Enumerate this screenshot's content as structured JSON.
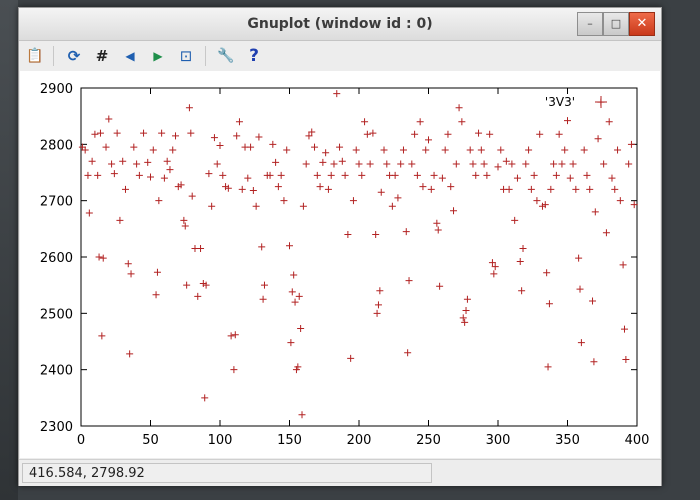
{
  "window": {
    "title": "Gnuplot (window id : 0)",
    "controls": {
      "minimize": "–",
      "maximize": "□",
      "close": "✕"
    }
  },
  "toolbar": {
    "items": [
      {
        "icon": "copy-clipboard-icon",
        "glyph": "📋"
      },
      {
        "icon": "replot-icon",
        "glyph": "⟳"
      },
      {
        "icon": "grid-icon",
        "glyph": "#"
      },
      {
        "icon": "zoom-previous-icon",
        "glyph": "◀"
      },
      {
        "icon": "zoom-next-icon",
        "glyph": "▶"
      },
      {
        "icon": "autoscale-icon",
        "glyph": "⊡"
      },
      {
        "icon": "options-wrench-icon",
        "glyph": "🔧"
      },
      {
        "icon": "help-icon",
        "glyph": "?"
      }
    ]
  },
  "status": {
    "coords": "416.584,  2798.92"
  },
  "colors": {
    "series": "#b22222",
    "axis": "#000000",
    "background": "#ffffff"
  },
  "chart_data": {
    "type": "scatter",
    "title": "",
    "xlabel": "",
    "ylabel": "",
    "xlim": [
      0,
      400
    ],
    "ylim": [
      2300,
      2900
    ],
    "xticks": [
      0,
      50,
      100,
      150,
      200,
      250,
      300,
      350,
      400
    ],
    "yticks": [
      2300,
      2400,
      2500,
      2600,
      2700,
      2800,
      2900
    ],
    "grid": false,
    "legend": {
      "position": "top-right",
      "entries": [
        "'3V3'"
      ]
    },
    "series": [
      {
        "name": "'3V3'",
        "points": [
          [
            1,
            2795
          ],
          [
            3,
            2790
          ],
          [
            5,
            2745
          ],
          [
            6,
            2678
          ],
          [
            8,
            2770
          ],
          [
            10,
            2818
          ],
          [
            12,
            2745
          ],
          [
            13,
            2600
          ],
          [
            14,
            2820
          ],
          [
            15,
            2460
          ],
          [
            16,
            2598
          ],
          [
            18,
            2795
          ],
          [
            20,
            2845
          ],
          [
            22,
            2765
          ],
          [
            24,
            2748
          ],
          [
            26,
            2820
          ],
          [
            28,
            2665
          ],
          [
            30,
            2770
          ],
          [
            32,
            2720
          ],
          [
            34,
            2588
          ],
          [
            35,
            2428
          ],
          [
            36,
            2570
          ],
          [
            38,
            2795
          ],
          [
            40,
            2765
          ],
          [
            42,
            2745
          ],
          [
            45,
            2820
          ],
          [
            48,
            2768
          ],
          [
            50,
            2742
          ],
          [
            52,
            2790
          ],
          [
            54,
            2533
          ],
          [
            55,
            2573
          ],
          [
            56,
            2700
          ],
          [
            58,
            2820
          ],
          [
            60,
            2740
          ],
          [
            62,
            2770
          ],
          [
            64,
            2755
          ],
          [
            66,
            2790
          ],
          [
            68,
            2815
          ],
          [
            70,
            2725
          ],
          [
            72,
            2728
          ],
          [
            74,
            2665
          ],
          [
            75,
            2655
          ],
          [
            76,
            2550
          ],
          [
            78,
            2865
          ],
          [
            79,
            2820
          ],
          [
            80,
            2708
          ],
          [
            82,
            2615
          ],
          [
            84,
            2530
          ],
          [
            86,
            2615
          ],
          [
            88,
            2553
          ],
          [
            89,
            2350
          ],
          [
            90,
            2550
          ],
          [
            92,
            2748
          ],
          [
            94,
            2690
          ],
          [
            96,
            2812
          ],
          [
            98,
            2765
          ],
          [
            100,
            2798
          ],
          [
            102,
            2745
          ],
          [
            104,
            2725
          ],
          [
            106,
            2722
          ],
          [
            108,
            2460
          ],
          [
            110,
            2400
          ],
          [
            111,
            2462
          ],
          [
            112,
            2815
          ],
          [
            114,
            2840
          ],
          [
            116,
            2720
          ],
          [
            118,
            2795
          ],
          [
            120,
            2740
          ],
          [
            122,
            2795
          ],
          [
            124,
            2718
          ],
          [
            126,
            2690
          ],
          [
            128,
            2813
          ],
          [
            130,
            2618
          ],
          [
            131,
            2525
          ],
          [
            132,
            2550
          ],
          [
            134,
            2745
          ],
          [
            136,
            2745
          ],
          [
            138,
            2800
          ],
          [
            140,
            2768
          ],
          [
            142,
            2725
          ],
          [
            144,
            2745
          ],
          [
            146,
            2700
          ],
          [
            148,
            2790
          ],
          [
            150,
            2620
          ],
          [
            151,
            2448
          ],
          [
            152,
            2538
          ],
          [
            153,
            2568
          ],
          [
            154,
            2520
          ],
          [
            155,
            2400
          ],
          [
            156,
            2405
          ],
          [
            157,
            2530
          ],
          [
            158,
            2473
          ],
          [
            159,
            2320
          ],
          [
            160,
            2690
          ],
          [
            162,
            2765
          ],
          [
            164,
            2815
          ],
          [
            166,
            2822
          ],
          [
            168,
            2795
          ],
          [
            170,
            2745
          ],
          [
            172,
            2725
          ],
          [
            174,
            2768
          ],
          [
            176,
            2785
          ],
          [
            178,
            2720
          ],
          [
            180,
            2745
          ],
          [
            182,
            2765
          ],
          [
            184,
            2890
          ],
          [
            186,
            2795
          ],
          [
            188,
            2770
          ],
          [
            190,
            2745
          ],
          [
            192,
            2640
          ],
          [
            194,
            2420
          ],
          [
            196,
            2700
          ],
          [
            198,
            2790
          ],
          [
            200,
            2765
          ],
          [
            202,
            2745
          ],
          [
            204,
            2840
          ],
          [
            206,
            2818
          ],
          [
            208,
            2765
          ],
          [
            210,
            2820
          ],
          [
            212,
            2640
          ],
          [
            213,
            2500
          ],
          [
            214,
            2515
          ],
          [
            215,
            2540
          ],
          [
            216,
            2715
          ],
          [
            218,
            2790
          ],
          [
            220,
            2765
          ],
          [
            222,
            2745
          ],
          [
            224,
            2690
          ],
          [
            226,
            2745
          ],
          [
            228,
            2705
          ],
          [
            230,
            2765
          ],
          [
            232,
            2790
          ],
          [
            234,
            2645
          ],
          [
            235,
            2430
          ],
          [
            236,
            2558
          ],
          [
            238,
            2765
          ],
          [
            240,
            2818
          ],
          [
            242,
            2745
          ],
          [
            244,
            2840
          ],
          [
            246,
            2725
          ],
          [
            248,
            2790
          ],
          [
            250,
            2808
          ],
          [
            252,
            2720
          ],
          [
            254,
            2745
          ],
          [
            256,
            2660
          ],
          [
            257,
            2648
          ],
          [
            258,
            2548
          ],
          [
            260,
            2740
          ],
          [
            262,
            2790
          ],
          [
            264,
            2818
          ],
          [
            266,
            2725
          ],
          [
            268,
            2682
          ],
          [
            270,
            2765
          ],
          [
            272,
            2865
          ],
          [
            274,
            2840
          ],
          [
            275,
            2492
          ],
          [
            276,
            2484
          ],
          [
            277,
            2505
          ],
          [
            278,
            2525
          ],
          [
            280,
            2790
          ],
          [
            282,
            2765
          ],
          [
            284,
            2745
          ],
          [
            286,
            2820
          ],
          [
            288,
            2790
          ],
          [
            290,
            2765
          ],
          [
            292,
            2745
          ],
          [
            294,
            2818
          ],
          [
            296,
            2590
          ],
          [
            297,
            2570
          ],
          [
            298,
            2583
          ],
          [
            300,
            2760
          ],
          [
            302,
            2790
          ],
          [
            304,
            2720
          ],
          [
            306,
            2770
          ],
          [
            308,
            2720
          ],
          [
            310,
            2765
          ],
          [
            312,
            2665
          ],
          [
            314,
            2740
          ],
          [
            316,
            2592
          ],
          [
            317,
            2540
          ],
          [
            318,
            2615
          ],
          [
            320,
            2765
          ],
          [
            322,
            2790
          ],
          [
            324,
            2720
          ],
          [
            326,
            2745
          ],
          [
            328,
            2700
          ],
          [
            330,
            2818
          ],
          [
            332,
            2690
          ],
          [
            334,
            2693
          ],
          [
            335,
            2572
          ],
          [
            336,
            2405
          ],
          [
            337,
            2517
          ],
          [
            338,
            2720
          ],
          [
            340,
            2765
          ],
          [
            342,
            2745
          ],
          [
            344,
            2818
          ],
          [
            346,
            2765
          ],
          [
            348,
            2790
          ],
          [
            350,
            2842
          ],
          [
            352,
            2740
          ],
          [
            354,
            2765
          ],
          [
            356,
            2720
          ],
          [
            358,
            2598
          ],
          [
            359,
            2543
          ],
          [
            360,
            2448
          ],
          [
            362,
            2790
          ],
          [
            364,
            2745
          ],
          [
            366,
            2720
          ],
          [
            368,
            2522
          ],
          [
            369,
            2414
          ],
          [
            370,
            2680
          ],
          [
            372,
            2810
          ],
          [
            374,
            2875
          ],
          [
            376,
            2765
          ],
          [
            378,
            2643
          ],
          [
            380,
            2840
          ],
          [
            382,
            2740
          ],
          [
            384,
            2720
          ],
          [
            386,
            2790
          ],
          [
            388,
            2700
          ],
          [
            390,
            2586
          ],
          [
            391,
            2472
          ],
          [
            392,
            2418
          ],
          [
            394,
            2765
          ],
          [
            396,
            2800
          ],
          [
            398,
            2693
          ]
        ]
      }
    ]
  }
}
